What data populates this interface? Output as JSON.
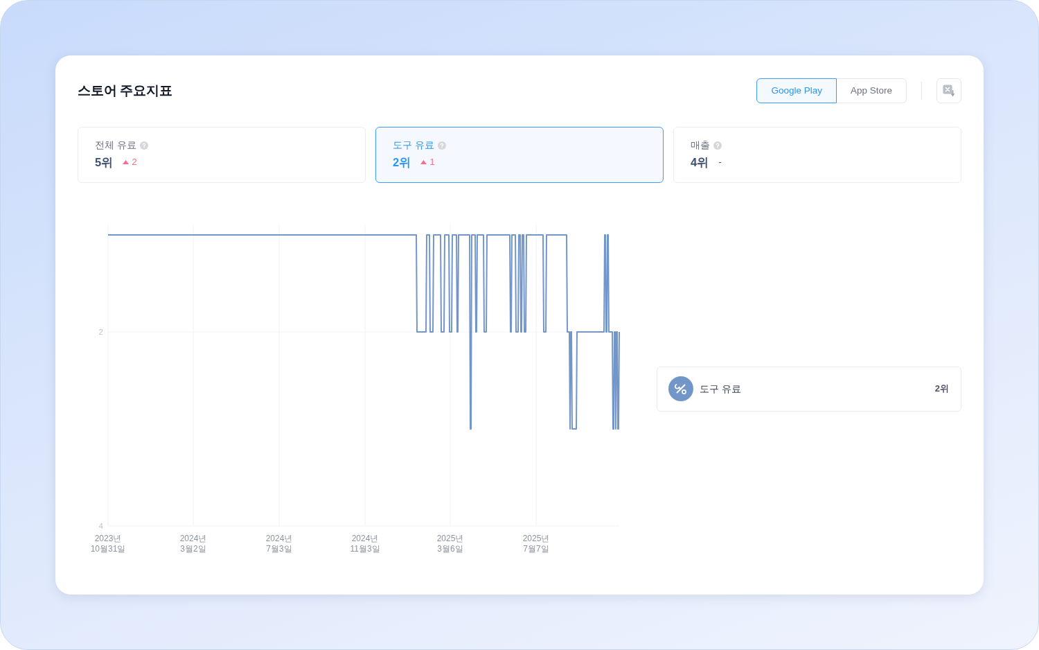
{
  "header": {
    "title": "스토어 주요지표"
  },
  "store_tabs": [
    {
      "label": "Google Play",
      "selected": true
    },
    {
      "label": "App Store",
      "selected": false
    }
  ],
  "metrics": [
    {
      "label": "전체 유료",
      "value": "5위",
      "rising": true,
      "change": "2",
      "selected": false
    },
    {
      "label": "도구 유료",
      "value": "2위",
      "rising": true,
      "change": "1",
      "selected": true
    },
    {
      "label": "매출",
      "value": "4위",
      "rising": false,
      "change": "-",
      "selected": false
    }
  ],
  "chart": {
    "chart_data": {
      "type": "line",
      "grid": true,
      "categories": [
        "2023년 10월31일",
        null,
        null,
        null,
        null,
        null,
        null,
        null,
        null,
        null,
        null,
        null,
        null,
        null,
        null,
        null,
        null,
        null,
        null,
        null,
        null,
        null,
        null,
        null,
        null,
        null,
        null,
        null,
        null,
        null,
        null,
        null,
        null,
        null,
        null,
        null,
        null,
        null,
        null,
        null,
        null,
        null,
        null,
        null,
        null,
        null,
        null,
        null,
        null,
        null,
        null,
        null,
        null,
        null,
        null,
        null,
        null,
        null,
        null,
        null,
        null,
        null,
        null,
        null,
        null,
        null,
        null,
        null,
        null,
        null,
        null,
        null,
        null,
        null,
        null,
        null,
        null,
        null,
        null,
        null,
        null,
        null,
        null,
        null,
        null,
        null,
        null,
        null,
        null,
        null,
        null,
        null,
        null,
        null,
        null,
        null,
        null,
        null,
        null,
        null,
        null,
        null,
        null,
        null,
        null,
        null,
        null,
        null,
        null,
        null,
        null,
        null,
        null,
        null,
        null,
        null,
        null,
        null,
        null,
        null,
        null,
        null,
        null,
        "2024년 3월2일",
        null,
        null,
        null,
        null,
        null,
        null,
        null,
        null,
        null,
        null,
        null,
        null,
        null,
        null,
        null,
        null,
        null,
        null,
        null,
        null,
        null,
        null,
        null,
        null,
        null,
        null,
        null,
        null,
        null,
        null,
        null,
        null,
        null,
        null,
        null,
        null,
        null,
        null,
        null,
        null,
        null,
        null,
        null,
        null,
        null,
        null,
        null,
        null,
        null,
        null,
        null,
        null,
        null,
        null,
        null,
        null,
        null,
        null,
        null,
        null,
        null,
        null,
        null,
        null,
        null,
        null,
        null,
        null,
        null,
        null,
        null,
        null,
        null,
        null,
        null,
        null,
        null,
        null,
        null,
        null,
        null,
        null,
        null,
        null,
        null,
        null,
        null,
        null,
        null,
        null,
        null,
        null,
        null,
        null,
        null,
        null,
        null,
        null,
        null,
        null,
        null,
        null,
        null,
        null,
        null,
        null,
        null,
        null,
        null,
        null,
        null,
        null,
        null,
        null,
        null,
        null,
        null,
        null,
        null,
        null,
        null,
        null,
        null,
        "2024년 7월3일",
        null,
        null,
        null,
        null,
        null,
        null,
        null,
        null,
        null,
        null,
        null,
        null,
        null,
        null,
        null,
        null,
        null,
        null,
        null,
        null,
        null,
        null,
        null,
        null,
        null,
        null,
        null,
        null,
        null,
        null,
        null,
        null,
        null,
        null,
        null,
        null,
        null,
        null,
        null,
        null,
        null,
        null,
        null,
        null,
        null,
        null,
        null,
        null,
        null,
        null,
        null,
        null,
        null,
        null,
        null,
        null,
        null,
        null,
        null,
        null,
        null,
        null,
        null,
        null,
        null,
        null,
        null,
        null,
        null,
        null,
        null,
        null,
        null,
        null,
        null,
        null,
        null,
        null,
        null,
        null,
        null,
        null,
        null,
        null,
        null,
        null,
        null,
        null,
        null,
        null,
        null,
        null,
        null,
        null,
        null,
        null,
        null,
        null,
        null,
        null,
        null,
        null,
        null,
        null,
        null,
        null,
        null,
        null,
        null,
        null,
        null,
        null,
        null,
        null,
        null,
        null,
        null,
        null,
        null,
        null,
        null,
        null,
        null,
        "2024년 11월3일",
        null,
        null,
        null,
        null,
        null,
        null,
        null,
        null,
        null,
        null,
        null,
        null,
        null,
        null,
        null,
        null,
        null,
        null,
        null,
        null,
        null,
        null,
        null,
        null,
        null,
        null,
        null,
        null,
        null,
        null,
        null,
        null,
        null,
        null,
        null,
        null,
        null,
        null,
        null,
        null,
        null,
        null,
        null,
        null,
        null,
        null,
        null,
        null,
        null,
        null,
        null,
        null,
        null,
        null,
        null,
        null,
        null,
        null,
        null,
        null,
        null,
        null,
        null,
        null,
        null,
        null,
        null,
        null,
        null,
        null,
        null,
        null,
        null,
        null,
        null,
        null,
        null,
        null,
        null,
        null,
        null,
        null,
        null,
        null,
        null,
        null,
        null,
        null,
        null,
        null,
        null,
        null,
        null,
        null,
        null,
        null,
        null,
        null,
        null,
        null,
        null,
        null,
        null,
        null,
        null,
        null,
        null,
        null,
        null,
        null,
        null,
        null,
        null,
        null,
        null,
        null,
        null,
        null,
        null,
        null,
        null,
        null,
        "2025년 3월6일",
        null,
        null,
        null,
        null,
        null,
        null,
        null,
        null,
        null,
        null,
        null,
        null,
        null,
        null,
        null,
        null,
        null,
        null,
        null,
        null,
        null,
        null,
        null,
        null,
        null,
        null,
        null,
        null,
        null,
        null,
        null,
        null,
        null,
        null,
        null,
        null,
        null,
        null,
        null,
        null,
        null,
        null,
        null,
        null,
        null,
        null,
        null,
        null,
        null,
        null,
        null,
        null,
        null,
        null,
        null,
        null,
        null,
        null,
        null,
        null,
        null,
        null,
        null,
        null,
        null,
        null,
        null,
        null,
        null,
        null,
        null,
        null,
        null,
        null,
        null,
        null,
        null,
        null,
        null,
        null,
        null,
        null,
        null,
        null,
        null,
        null,
        null,
        null,
        null,
        null,
        null,
        null,
        null,
        null,
        null,
        null,
        null,
        null,
        null,
        null,
        null,
        null,
        null,
        null,
        null,
        null,
        null,
        null,
        null,
        null,
        null,
        null,
        null,
        null,
        null,
        null,
        null,
        null,
        null,
        null,
        null,
        null,
        null,
        "2025년 7월7일",
        null,
        null,
        null,
        null,
        null,
        null,
        null,
        null,
        null,
        null,
        null,
        null,
        null,
        null,
        null,
        null,
        null,
        null,
        null,
        null,
        null,
        null,
        null,
        null,
        null,
        null,
        null,
        null,
        null,
        null,
        null,
        null,
        null,
        null,
        null,
        null,
        null,
        null,
        null,
        null,
        null,
        null,
        null,
        null,
        null,
        null,
        null,
        null,
        null,
        null,
        null,
        null,
        null,
        null,
        null,
        null,
        null,
        null,
        null,
        null,
        null,
        null,
        null,
        null,
        null,
        null,
        null,
        null,
        null,
        null,
        null,
        null,
        null,
        null,
        null,
        null,
        null,
        null,
        null,
        null,
        null,
        null,
        null,
        null,
        null,
        null,
        null,
        null,
        null,
        null,
        null,
        null,
        null,
        null,
        null,
        null,
        null,
        null,
        null,
        null,
        null,
        null,
        null,
        null,
        null,
        null,
        null,
        null,
        null,
        null,
        null,
        null,
        null,
        null,
        null,
        null,
        null,
        null,
        null,
        null
      ],
      "series": [
        {
          "name": "도구 유료",
          "color": "#7396c9",
          "values": [
            1,
            1,
            1,
            1,
            1,
            1,
            1,
            1,
            1,
            1,
            1,
            1,
            1,
            1,
            1,
            1,
            1,
            1,
            1,
            1,
            1,
            1,
            1,
            1,
            1,
            1,
            1,
            1,
            1,
            1,
            1,
            1,
            1,
            1,
            1,
            1,
            1,
            1,
            1,
            1,
            1,
            1,
            1,
            1,
            1,
            1,
            1,
            1,
            1,
            1,
            1,
            1,
            1,
            1,
            1,
            1,
            1,
            1,
            1,
            1,
            1,
            1,
            1,
            1,
            1,
            1,
            1,
            1,
            1,
            1,
            1,
            1,
            1,
            1,
            1,
            1,
            1,
            1,
            1,
            1,
            1,
            1,
            1,
            1,
            1,
            1,
            1,
            1,
            1,
            1,
            1,
            1,
            1,
            1,
            1,
            1,
            1,
            1,
            1,
            1,
            1,
            1,
            1,
            1,
            1,
            1,
            1,
            1,
            1,
            1,
            1,
            1,
            1,
            1,
            1,
            1,
            1,
            1,
            1,
            1,
            1,
            1,
            1,
            1,
            1,
            1,
            1,
            1,
            1,
            1,
            1,
            1,
            1,
            1,
            1,
            1,
            1,
            1,
            1,
            1,
            1,
            1,
            1,
            1,
            1,
            1,
            1,
            1,
            1,
            1,
            1,
            1,
            1,
            1,
            1,
            1,
            1,
            1,
            1,
            1,
            1,
            1,
            1,
            1,
            1,
            1,
            1,
            1,
            1,
            1,
            1,
            1,
            1,
            1,
            1,
            1,
            1,
            1,
            1,
            1,
            1,
            1,
            1,
            1,
            1,
            1,
            1,
            1,
            1,
            1,
            1,
            1,
            1,
            1,
            1,
            1,
            1,
            1,
            1,
            1,
            1,
            1,
            1,
            1,
            1,
            1,
            1,
            1,
            1,
            1,
            1,
            1,
            1,
            1,
            1,
            1,
            1,
            1,
            1,
            1,
            1,
            1,
            1,
            1,
            1,
            1,
            1,
            1,
            1,
            1,
            1,
            1,
            1,
            1,
            1,
            1,
            1,
            1,
            1,
            1,
            1,
            1,
            1,
            1,
            1,
            1,
            1,
            1,
            1,
            1,
            1,
            1,
            1,
            1,
            1,
            1,
            1,
            1,
            1,
            1,
            1,
            1,
            1,
            1,
            1,
            1,
            1,
            1,
            1,
            1,
            1,
            1,
            1,
            1,
            1,
            1,
            1,
            1,
            1,
            1,
            1,
            1,
            1,
            1,
            1,
            1,
            1,
            1,
            1,
            1,
            1,
            1,
            1,
            1,
            1,
            1,
            1,
            1,
            1,
            1,
            1,
            1,
            1,
            1,
            1,
            1,
            1,
            1,
            1,
            1,
            1,
            1,
            1,
            1,
            1,
            1,
            1,
            1,
            1,
            1,
            1,
            1,
            1,
            1,
            1,
            1,
            1,
            1,
            1,
            1,
            1,
            1,
            1,
            1,
            1,
            1,
            1,
            1,
            1,
            1,
            1,
            1,
            1,
            1,
            1,
            1,
            1,
            1,
            1,
            1,
            1,
            1,
            1,
            1,
            1,
            1,
            1,
            1,
            1,
            1,
            1,
            1,
            1,
            1,
            1,
            1,
            1,
            1,
            1,
            1,
            1,
            1,
            1,
            1,
            1,
            1,
            1,
            1,
            1,
            1,
            1,
            1,
            1,
            1,
            1,
            1,
            1,
            1,
            1,
            1,
            1,
            1,
            1,
            1,
            1,
            1,
            1,
            1,
            1,
            1,
            1,
            1,
            1,
            1,
            1,
            1,
            1,
            1,
            1,
            1,
            1,
            1,
            1,
            1,
            1,
            1,
            1,
            1,
            1,
            1,
            1,
            1,
            1,
            1,
            1,
            1,
            1,
            1,
            1,
            1,
            1,
            1,
            1,
            1,
            1,
            1,
            1,
            1,
            1,
            1,
            1,
            1,
            1,
            1,
            1,
            1,
            2,
            2,
            2,
            2,
            2,
            2,
            2,
            2,
            2,
            2,
            2,
            2,
            2,
            2,
            1,
            1,
            1,
            1,
            1,
            2,
            2,
            2,
            2,
            2,
            1,
            1,
            1,
            1,
            1,
            1,
            1,
            1,
            1,
            1,
            1,
            2,
            2,
            2,
            2,
            2,
            1,
            1,
            1,
            1,
            1,
            1,
            1,
            2,
            2,
            2,
            2,
            1,
            1,
            1,
            1,
            1,
            1,
            1,
            2,
            2,
            1,
            1,
            1,
            1,
            1,
            1,
            1,
            1,
            1,
            1,
            1,
            1,
            1,
            1,
            1,
            1,
            1,
            3,
            3,
            1,
            1,
            1,
            1,
            1,
            1,
            2,
            2,
            1,
            1,
            1,
            1,
            1,
            1,
            1,
            1,
            1,
            1,
            2,
            2,
            2,
            2,
            1,
            1,
            1,
            1,
            1,
            1,
            1,
            1,
            1,
            1,
            1,
            1,
            1,
            1,
            1,
            1,
            1,
            1,
            1,
            1,
            1,
            1,
            1,
            1,
            1,
            1,
            1,
            1,
            1,
            1,
            1,
            1,
            1,
            1,
            2,
            2,
            1,
            1,
            1,
            1,
            1,
            1,
            2,
            2,
            2,
            2,
            1,
            1,
            1,
            2,
            2,
            1,
            1,
            1,
            2,
            2,
            2,
            1,
            1,
            1,
            1,
            1,
            1,
            1,
            1,
            1,
            1,
            1,
            1,
            1,
            1,
            1,
            1,
            1,
            1,
            1,
            1,
            1,
            1,
            1,
            1,
            1,
            2,
            2,
            2,
            2,
            1,
            1,
            1,
            1,
            1,
            1,
            1,
            1,
            1,
            1,
            1,
            1,
            1,
            1,
            1,
            1,
            1,
            1,
            1,
            1,
            1,
            1,
            1,
            1,
            1,
            1,
            1,
            1,
            1,
            1,
            2,
            2,
            2,
            2,
            3,
            2,
            2,
            3,
            3,
            3,
            3,
            3,
            3,
            3,
            2,
            2,
            2,
            2,
            2,
            2,
            2,
            2,
            2,
            2,
            2,
            2,
            2,
            2,
            2,
            2,
            2,
            2,
            2,
            2,
            2,
            2,
            2,
            2,
            2,
            2,
            2,
            2,
            2,
            2,
            2,
            2,
            2,
            2,
            2,
            2,
            2,
            2,
            2,
            2,
            1,
            1,
            2,
            2,
            1,
            1,
            2,
            2,
            2,
            2,
            2,
            2,
            3,
            3,
            2,
            2,
            3,
            2,
            2,
            3,
            3,
            2
          ]
        }
      ],
      "ylim": [
        4,
        0.9
      ],
      "yticks": [
        2,
        4
      ]
    },
    "legend": {
      "value": "2위"
    }
  }
}
